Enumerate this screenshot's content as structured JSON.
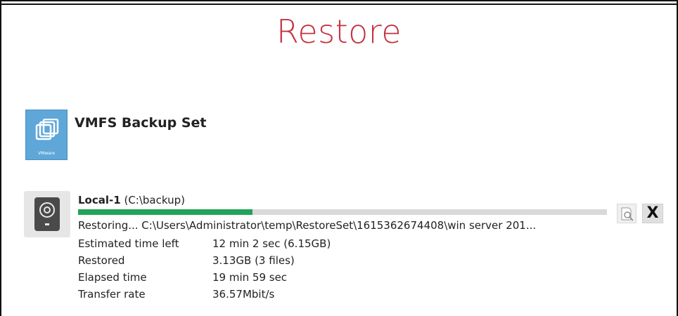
{
  "page": {
    "title": "Restore"
  },
  "backup_set": {
    "name": "VMFS Backup Set",
    "icon": "vmware-icon",
    "icon_label": "VMware"
  },
  "destination": {
    "icon": "hard-drive-icon",
    "name": "Local-1",
    "path": "(C:\\backup)",
    "progress": 0.33,
    "status": "Restoring... C:\\Users\\Administrator\\temp\\RestoreSet\\1615362674408\\win server 201...",
    "stats": [
      {
        "label": "Estimated time left",
        "value": "12 min 2 sec (6.15GB)"
      },
      {
        "label": "Restored",
        "value": "3.13GB (3 files)"
      },
      {
        "label": "Elapsed time",
        "value": "19 min 59 sec"
      },
      {
        "label": "Transfer rate",
        "value": "36.57Mbit/s"
      }
    ]
  },
  "actions": {
    "view_log_icon": "magnifier-log-icon",
    "cancel_label": "X"
  },
  "colors": {
    "title": "#c6323f",
    "progress": "#21a35a",
    "progress_track": "#d9d9d9",
    "vmware_tile": "#5fa7d8"
  }
}
